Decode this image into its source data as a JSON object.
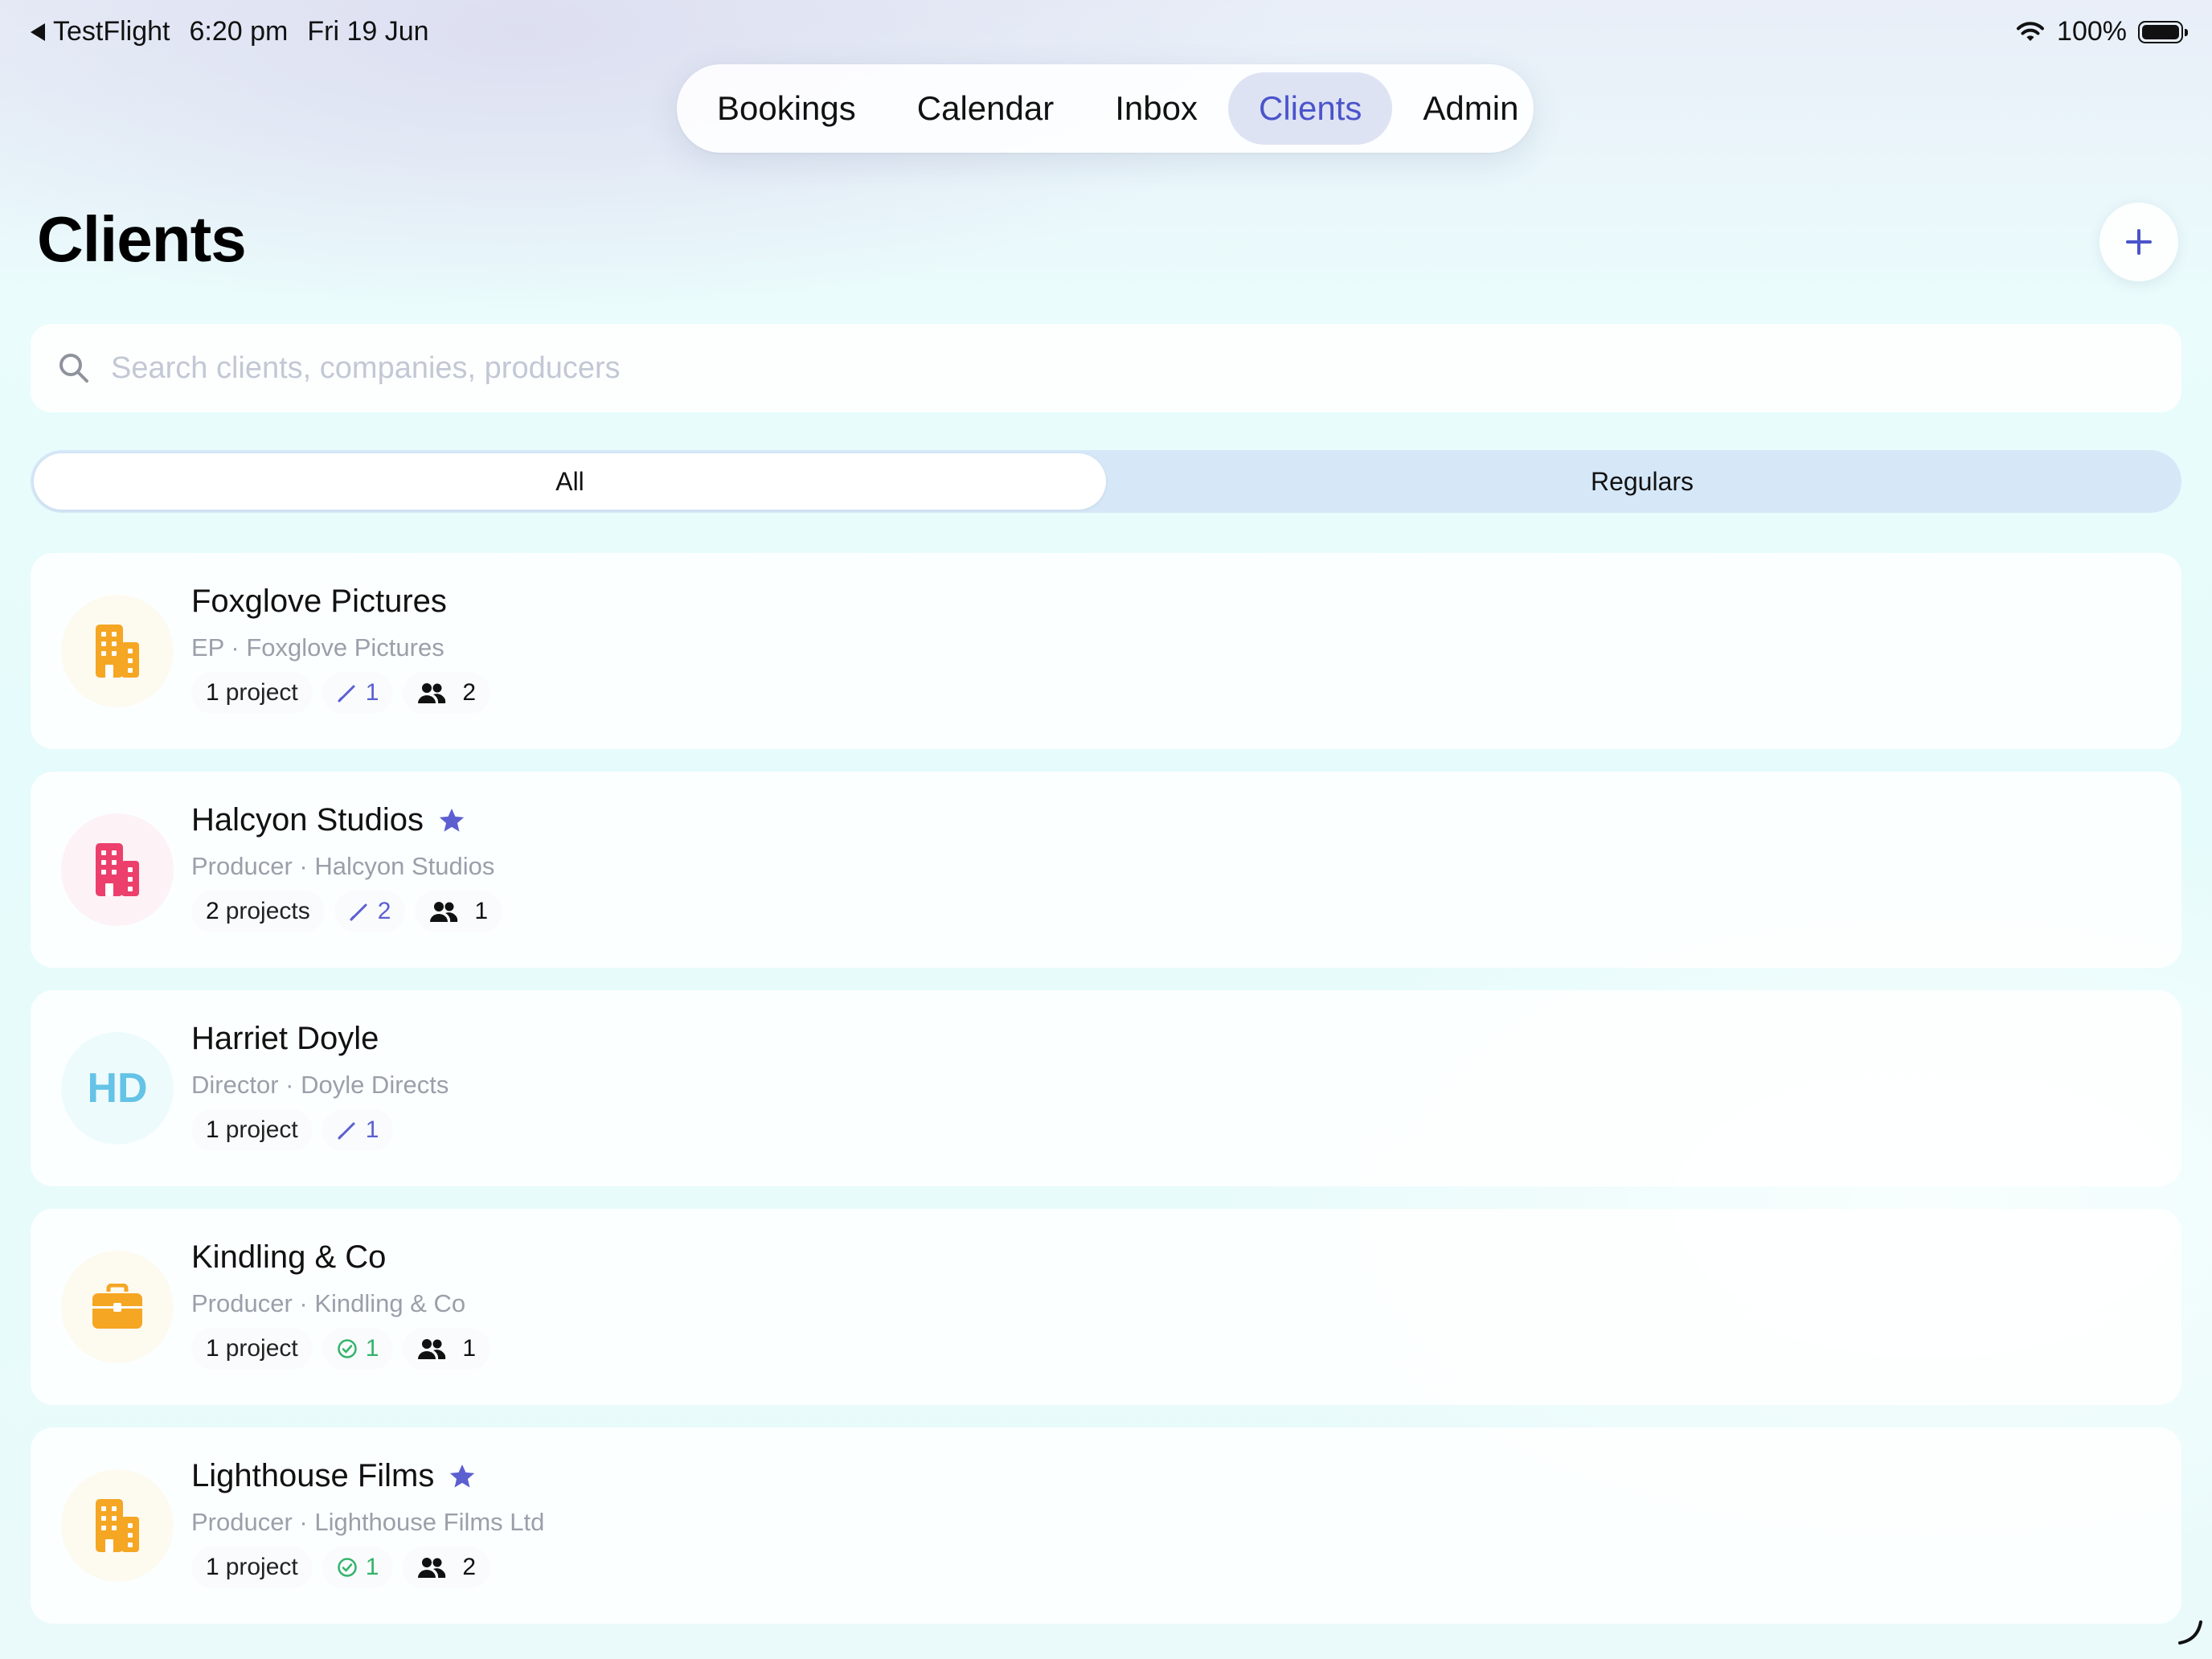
{
  "status_bar": {
    "back_label": "TestFlight",
    "time": "6:20 pm",
    "date": "Fri 19 Jun",
    "battery": "100%"
  },
  "tabs": [
    {
      "label": "Bookings",
      "active": false
    },
    {
      "label": "Calendar",
      "active": false
    },
    {
      "label": "Inbox",
      "active": false
    },
    {
      "label": "Clients",
      "active": true
    },
    {
      "label": "Admin",
      "active": false
    }
  ],
  "page": {
    "title": "Clients",
    "add_icon": "plus-icon"
  },
  "search": {
    "placeholder": "Search clients, companies, producers",
    "value": ""
  },
  "filter": {
    "segments": [
      "All",
      "Regulars"
    ],
    "selected": "All"
  },
  "accent_color": "#4b54c9",
  "clients": [
    {
      "name": "Foxglove Pictures",
      "starred": false,
      "subtitle": "EP · Foxglove Pictures",
      "avatar": {
        "type": "icon",
        "icon": "building-icon",
        "color": "#f5a623",
        "bg": "#fdfaf0"
      },
      "projects_count": "1",
      "projects_unit": "project",
      "status_icon": "pencil-icon",
      "status_count": "1",
      "people_count": "2"
    },
    {
      "name": "Halcyon Studios",
      "starred": true,
      "subtitle": "Producer · Halcyon Studios",
      "avatar": {
        "type": "icon",
        "icon": "building-icon",
        "color": "#ec3f6c",
        "bg": "#fdf2f6"
      },
      "projects_count": "2",
      "projects_unit": "projects",
      "status_icon": "pencil-icon",
      "status_count": "2",
      "people_count": "1"
    },
    {
      "name": "Harriet Doyle",
      "starred": false,
      "subtitle": "Director · Doyle Directs",
      "avatar": {
        "type": "initials",
        "initials": "HD",
        "color": "#64c3e6",
        "bg": "#eefbfc"
      },
      "projects_count": "1",
      "projects_unit": "project",
      "status_icon": "pencil-icon",
      "status_count": "1",
      "people_count": null
    },
    {
      "name": "Kindling & Co",
      "starred": false,
      "subtitle": "Producer · Kindling & Co",
      "avatar": {
        "type": "icon",
        "icon": "briefcase-icon",
        "color": "#f5a623",
        "bg": "#fdfaf0"
      },
      "projects_count": "1",
      "projects_unit": "project",
      "status_icon": "check-circle-icon",
      "status_count": "1",
      "people_count": "1"
    },
    {
      "name": "Lighthouse Films",
      "starred": true,
      "subtitle": "Producer · Lighthouse Films Ltd",
      "avatar": {
        "type": "icon",
        "icon": "building-icon",
        "color": "#f5a623",
        "bg": "#fdfaf0"
      },
      "projects_count": "1",
      "projects_unit": "project",
      "status_icon": "check-circle-icon",
      "status_count": "1",
      "people_count": "2"
    }
  ]
}
